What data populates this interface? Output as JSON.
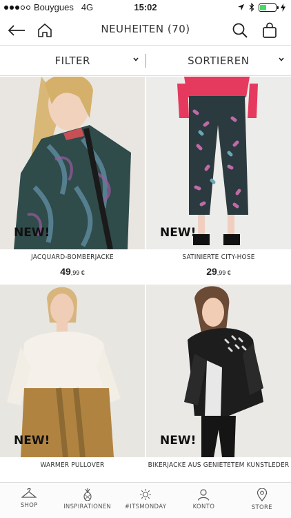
{
  "status_bar": {
    "carrier": "Bouygues",
    "network": "4G",
    "time": "15:02",
    "signal_bars": 3,
    "signal_max": 5,
    "battery_level": 0.4
  },
  "header": {
    "title": "NEUHEITEN (70)",
    "back_icon": "arrow-left-icon",
    "home_icon": "home-icon",
    "search_icon": "search-icon",
    "bag_icon": "shopping-bag-icon"
  },
  "filter_bar": {
    "filter_label": "FILTER",
    "sort_label": "SORTIEREN"
  },
  "products": [
    {
      "name": "JACQUARD-BOMBERJACKE",
      "price_main": "49",
      "price_cents": ",99 €",
      "badge": "NEW!"
    },
    {
      "name": "SATINIERTE CITY-HOSE",
      "price_main": "29",
      "price_cents": ",99 €",
      "badge": "NEW!"
    },
    {
      "name": "WARMER PULLOVER",
      "price_main": "",
      "price_cents": "",
      "badge": "NEW!"
    },
    {
      "name": "BIKERJACKE AUS GENIETETEM KUNSTLEDER",
      "price_main": "",
      "price_cents": "",
      "badge": "NEW!"
    }
  ],
  "tabs": [
    {
      "label": "SHOP",
      "icon": "hanger-icon"
    },
    {
      "label": "INSPIRATIONEN",
      "icon": "pineapple-icon"
    },
    {
      "label": "#ITSMONDAY",
      "icon": "sun-icon"
    },
    {
      "label": "KONTO",
      "icon": "user-icon"
    },
    {
      "label": "STORE",
      "icon": "location-pin-icon"
    }
  ],
  "colors": {
    "accent": "#111111",
    "battery": "#4cd964",
    "divider": "#dddddd"
  }
}
